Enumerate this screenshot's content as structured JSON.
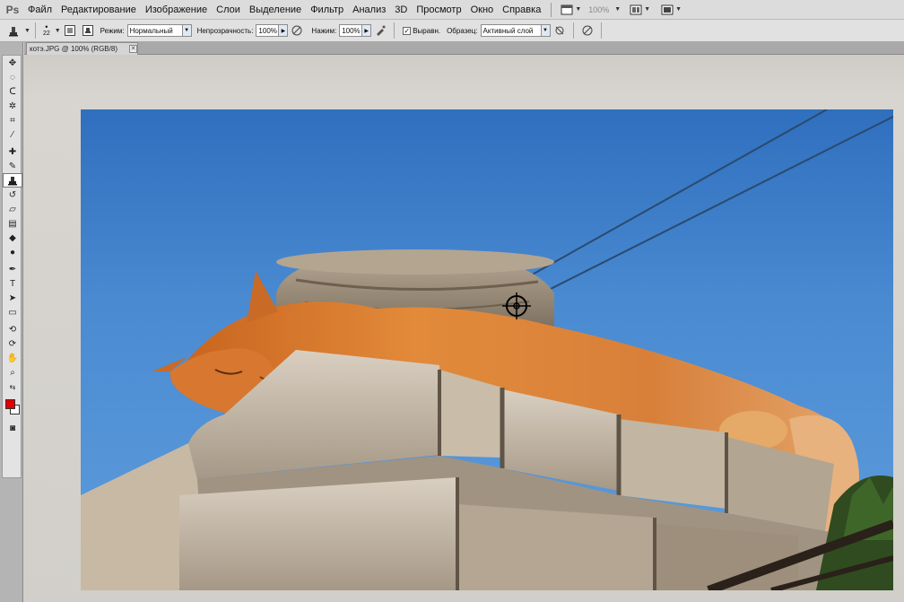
{
  "app": {
    "logo": "Ps",
    "menu": [
      "Файл",
      "Редактирование",
      "Изображение",
      "Слои",
      "Выделение",
      "Фильтр",
      "Анализ",
      "3D",
      "Просмотр",
      "Окно",
      "Справка"
    ],
    "zoom": "100%"
  },
  "options": {
    "brush_size": "22",
    "mode_label": "Режим:",
    "mode_value": "Нормальный",
    "opacity_label": "Непрозрачность:",
    "opacity_value": "100%",
    "flow_label": "Нажим:",
    "flow_value": "100%",
    "aligned_label": "Выравн.",
    "sample_label": "Образец:",
    "sample_value": "Активный слой"
  },
  "document": {
    "tab_title": "котэ.JPG @ 100% (RGB/8)",
    "close": "✕"
  },
  "toolbox": {
    "foreground_color": "#e00000",
    "background_color": "#ffffff",
    "active_tool": "clone-stamp"
  },
  "icons": {
    "crosshair": "clone-source-crosshair-icon"
  }
}
